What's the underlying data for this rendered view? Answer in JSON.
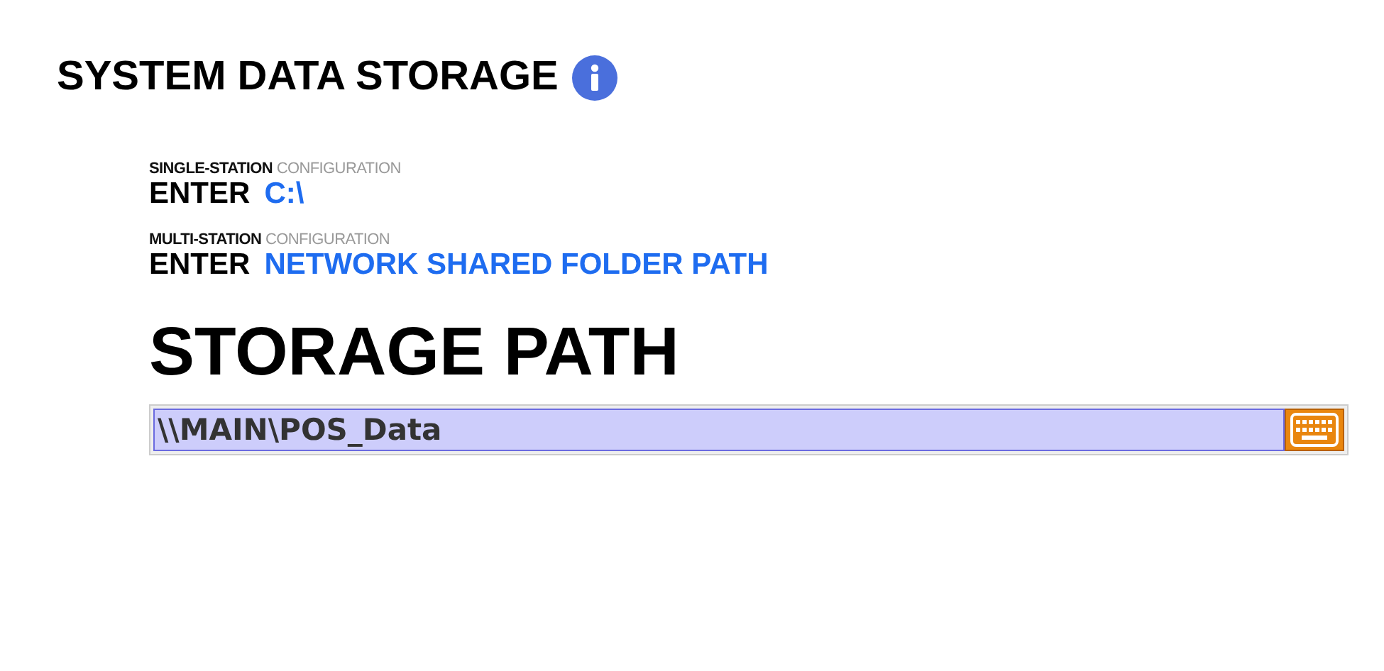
{
  "title": "SYSTEM DATA STORAGE",
  "options": [
    {
      "label": "**SINGLE-STATION** CONFIGURATION",
      "prefix": "ENTER",
      "value": "C:\\"
    },
    {
      "label": "**MULTI-STATION** CONFIGURATION",
      "prefix": "ENTER",
      "value": "NETWORK SHARED FOLDER PATH"
    }
  ],
  "storage_path": {
    "heading": "STORAGE PATH",
    "value": "\\\\MAIN\\POS_Data"
  }
}
